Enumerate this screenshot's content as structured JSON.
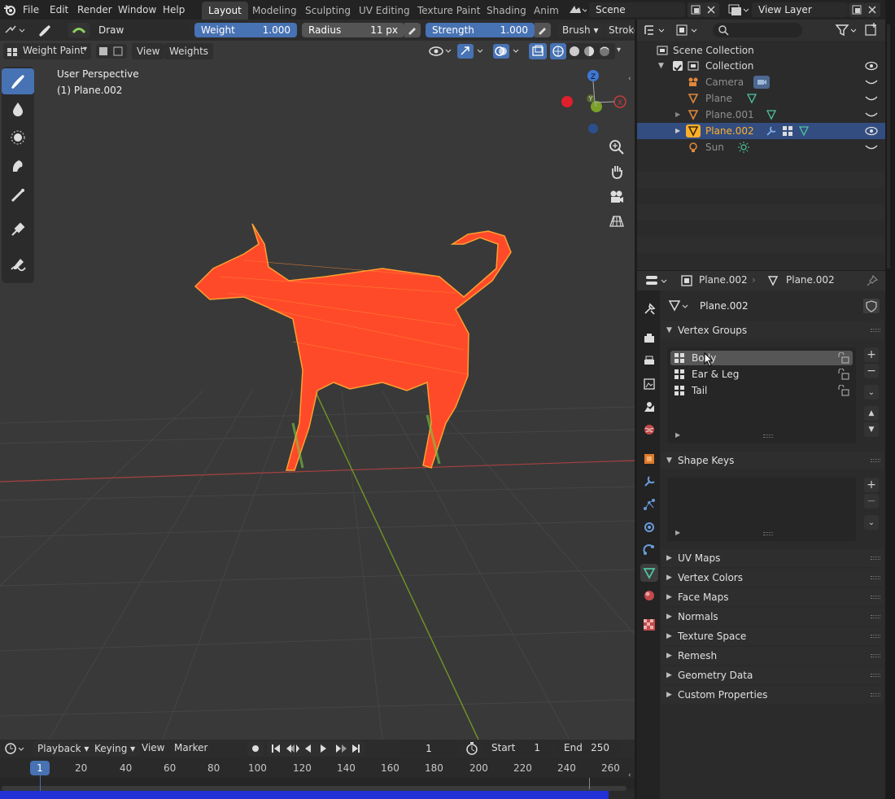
{
  "menu": [
    "File",
    "Edit",
    "Render",
    "Window",
    "Help"
  ],
  "workspaces": [
    "Layout",
    "Modeling",
    "Sculpting",
    "UV Editing",
    "Texture Paint",
    "Shading",
    "Anim"
  ],
  "scene": "Scene",
  "view_layer": "View Layer",
  "tool_header": {
    "brush_name": "Draw",
    "weight_label": "Weight",
    "weight_value": "1.000",
    "radius_label": "Radius",
    "radius_value": "11 px",
    "strength_label": "Strength",
    "strength_value": "1.000",
    "brush_menu": "Brush",
    "stroke_menu": "Stroke"
  },
  "viewport_header": {
    "mode": "Weight Paint",
    "view_menu": "View",
    "weights_menu": "Weights"
  },
  "viewport_overlay": {
    "perspective": "User Perspective",
    "object": "(1) Plane.002"
  },
  "gizmo": {
    "z": "Z",
    "y": "Y",
    "x": "X"
  },
  "outliner": {
    "root": "Scene Collection",
    "collection": "Collection",
    "items": [
      "Camera",
      "Plane",
      "Plane.001",
      "Plane.002",
      "Sun"
    ],
    "selected": "Plane.002"
  },
  "properties": {
    "breadcrumb_object": "Plane.002",
    "breadcrumb_data": "Plane.002",
    "mesh_name": "Plane.002",
    "panels": {
      "vertex_groups": "Vertex Groups",
      "shape_keys": "Shape Keys",
      "collapsed": [
        "UV Maps",
        "Vertex Colors",
        "Face Maps",
        "Normals",
        "Texture Space",
        "Remesh",
        "Geometry Data",
        "Custom Properties"
      ]
    },
    "vertex_groups": [
      "Body",
      "Ear & Leg",
      "Tail"
    ],
    "vertex_group_selected": "Body"
  },
  "timeline": {
    "menus": [
      "Playback",
      "Keying",
      "View",
      "Marker"
    ],
    "current_frame": "1",
    "start_label": "Start",
    "start_value": "1",
    "end_label": "End",
    "end_value": "250",
    "ticks": [
      "1",
      "20",
      "40",
      "60",
      "80",
      "100",
      "120",
      "140",
      "160",
      "180",
      "200",
      "220",
      "240",
      "260"
    ]
  },
  "colors": {
    "accent": "#4772b3",
    "selected_row": "#334d80",
    "viewport_bg": "#393939",
    "weight_paint": "#ff4a2a",
    "axis_x": "#c43c3c",
    "axis_y": "#7aa028",
    "active_object": "#ffaf29"
  }
}
